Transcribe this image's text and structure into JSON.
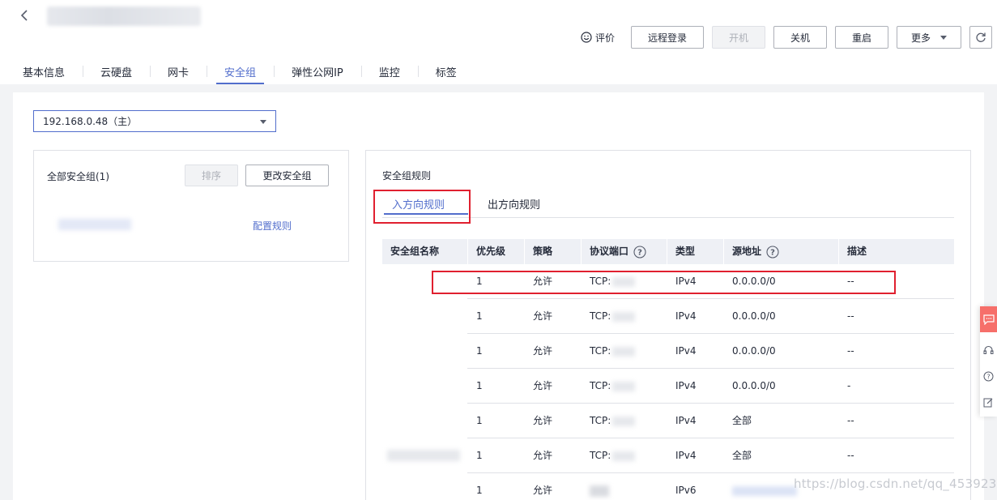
{
  "header": {
    "rate_label": "评价",
    "buttons": {
      "remote_login": "远程登录",
      "power_on": "开机",
      "shutdown": "关机",
      "restart": "重启",
      "more": "更多"
    }
  },
  "tabs": [
    {
      "label": "基本信息"
    },
    {
      "label": "云硬盘"
    },
    {
      "label": "网卡"
    },
    {
      "label": "安全组"
    },
    {
      "label": "弹性公网IP"
    },
    {
      "label": "监控"
    },
    {
      "label": "标签"
    }
  ],
  "active_tab": "安全组",
  "nic_select": {
    "value": "192.168.0.48（主）"
  },
  "security_groups": {
    "label": "全部安全组(1)",
    "sort_label": "排序",
    "change_label": "更改安全组",
    "configure_label": "配置规则"
  },
  "rules": {
    "title": "安全组规则",
    "tabs": {
      "inbound": "入方向规则",
      "outbound": "出方向规则"
    },
    "columns": [
      "安全组名称",
      "优先级",
      "策略",
      "协议端口",
      "类型",
      "源地址",
      "描述"
    ],
    "rows": [
      {
        "priority": "1",
        "policy": "允许",
        "protocol": "TCP:",
        "type": "IPv4",
        "source": "0.0.0.0/0",
        "desc": "--"
      },
      {
        "priority": "1",
        "policy": "允许",
        "protocol": "TCP:",
        "type": "IPv4",
        "source": "0.0.0.0/0",
        "desc": "--"
      },
      {
        "priority": "1",
        "policy": "允许",
        "protocol": "TCP:",
        "type": "IPv4",
        "source": "0.0.0.0/0",
        "desc": "--"
      },
      {
        "priority": "1",
        "policy": "允许",
        "protocol": "TCP:",
        "type": "IPv4",
        "source": "0.0.0.0/0",
        "desc": "-"
      },
      {
        "priority": "1",
        "policy": "允许",
        "protocol": "TCP:",
        "type": "IPv4",
        "source": "全部",
        "desc": "--"
      },
      {
        "priority": "1",
        "policy": "允许",
        "protocol": "TCP:",
        "type": "IPv4",
        "source": "全部",
        "desc": "--"
      },
      {
        "priority": "1",
        "policy": "允许",
        "protocol": "",
        "type": "IPv6",
        "source": "",
        "desc": ""
      }
    ]
  },
  "watermark": "https://blog.csdn.net/qq_45392321",
  "colors": {
    "accent": "#526ecc",
    "highlight": "#e0202f",
    "float_accent": "#f66f6a"
  }
}
